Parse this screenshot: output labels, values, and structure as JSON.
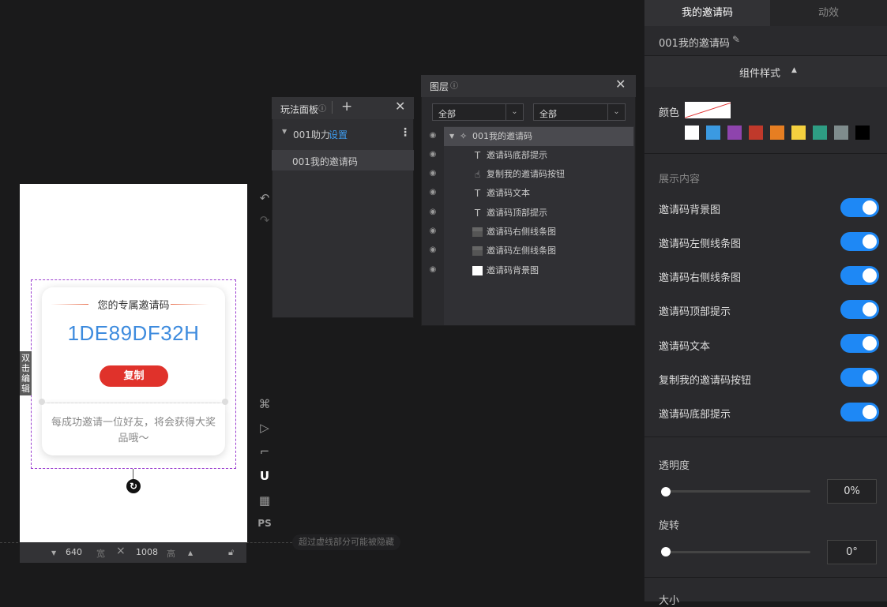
{
  "canvas": {
    "invite_title": "您的专属邀请码",
    "invite_code": "1DE89DF32H",
    "copy_button": "复制",
    "bottom_tip": "每成功邀请一位好友，将会获得大奖品哦～",
    "double_click_edit": "双击编辑",
    "width_value": "640",
    "width_unit": "宽",
    "height_value": "1008",
    "height_unit": "高",
    "hidden_note": "超过虚线部分可能被隐藏"
  },
  "tools": {
    "undo": "↶",
    "redo": "↷",
    "shortcut": "⌘",
    "play": "▷",
    "ruler": "⌐",
    "magnet": "U",
    "grid": "▦",
    "ps": "PS"
  },
  "play_panel": {
    "title": "玩法面板",
    "group_name": "001助力",
    "group_setting": "设置",
    "item": "001我的邀请码"
  },
  "layers_panel": {
    "title": "图层",
    "filter1": "全部",
    "filter2": "全部",
    "layers": [
      {
        "name": "001我的邀请码",
        "icon": "puzzle-icon"
      },
      {
        "name": "邀请码底部提示",
        "icon": "text-icon"
      },
      {
        "name": "复制我的邀请码按钮",
        "icon": "hand-icon"
      },
      {
        "name": "邀请码文本",
        "icon": "text-icon"
      },
      {
        "name": "邀请码顶部提示",
        "icon": "text-icon"
      },
      {
        "name": "邀请码右侧线条图",
        "icon": "image-icon"
      },
      {
        "name": "邀请码左侧线条图",
        "icon": "image-icon"
      },
      {
        "name": "邀请码背景图",
        "icon": "image-icon"
      }
    ]
  },
  "right_panel": {
    "tab_active": "我的邀请码",
    "tab_other": "动效",
    "component_name": "001我的邀请码",
    "style_section": "组件样式",
    "color_label": "颜色",
    "swatches": [
      "#ffffff",
      "#3b9ae1",
      "#8e44ad",
      "#c0392b",
      "#e67e22",
      "#f4d03f",
      "#2e9d83",
      "#7f8c8d",
      "#000000"
    ],
    "display_section": "展示内容",
    "toggles": [
      {
        "label": "邀请码背景图",
        "on": true
      },
      {
        "label": "邀请码左侧线条图",
        "on": true
      },
      {
        "label": "邀请码右侧线条图",
        "on": true
      },
      {
        "label": "邀请码顶部提示",
        "on": true
      },
      {
        "label": "邀请码文本",
        "on": true
      },
      {
        "label": "复制我的邀请码按钮",
        "on": true
      },
      {
        "label": "邀请码底部提示",
        "on": true
      }
    ],
    "opacity_label": "透明度",
    "opacity_value": "0%",
    "rotate_label": "旋转",
    "rotate_value": "0°",
    "size_label": "大小"
  },
  "colors": {
    "accent": "#1e88f5",
    "code_blue": "#3d8bde",
    "copy_red": "#e0322b",
    "selection": "#9b3fd0"
  }
}
